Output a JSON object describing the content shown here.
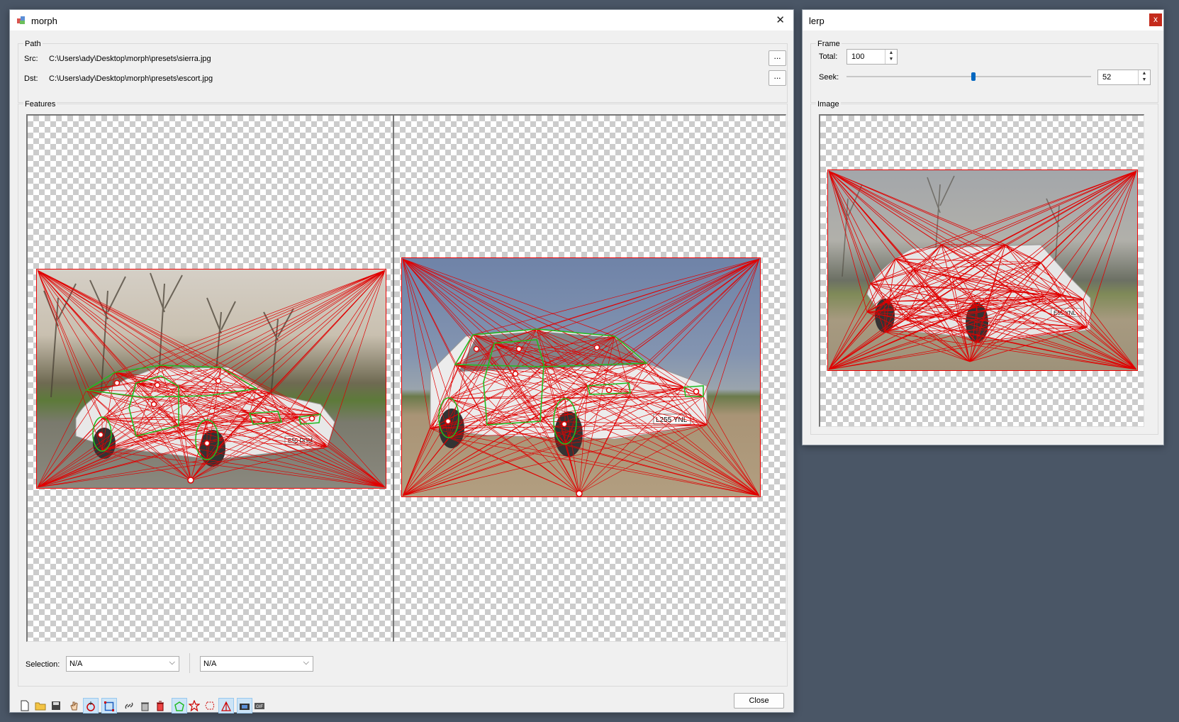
{
  "morph": {
    "title": "morph",
    "close_glyph": "✕",
    "path_group": "Path",
    "src_label": "Src:",
    "src_value": "C:\\Users\\ady\\Desktop\\morph\\presets\\sierra.jpg",
    "dst_label": "Dst:",
    "dst_value": "C:\\Users\\ady\\Desktop\\morph\\presets\\escort.jpg",
    "browse_label": "...",
    "features_group": "Features",
    "selection_label": "Selection:",
    "selection_left": "N/A",
    "selection_right": "N/A",
    "close_button": "Close",
    "plate_left": "E55 DGU",
    "plate_right": "L255 YNL",
    "toolbar": [
      "new-file-icon",
      "open-folder-icon",
      "save-icon",
      "hand-pan-icon",
      "add-point-icon",
      "select-rect-icon",
      "link-icon",
      "delete-features-icon",
      "trash-icon",
      "polygon-icon",
      "star-icon",
      "outline-icon",
      "triangulate-icon",
      "preview-icon",
      "gif-export-icon"
    ]
  },
  "lerp": {
    "title": "lerp",
    "close_glyph": "x",
    "frame_group": "Frame",
    "total_label": "Total:",
    "total_value": "100",
    "seek_label": "Seek:",
    "seek_value": "52",
    "seek_fraction": 0.52,
    "image_group": "Image",
    "plate_text": "E55 YNL"
  },
  "colors": {
    "desktop": "#4a5666",
    "mesh_red": "#e00000",
    "feature_green": "#22bb22",
    "accent": "#0067c0",
    "close_red": "#c42b1c"
  }
}
